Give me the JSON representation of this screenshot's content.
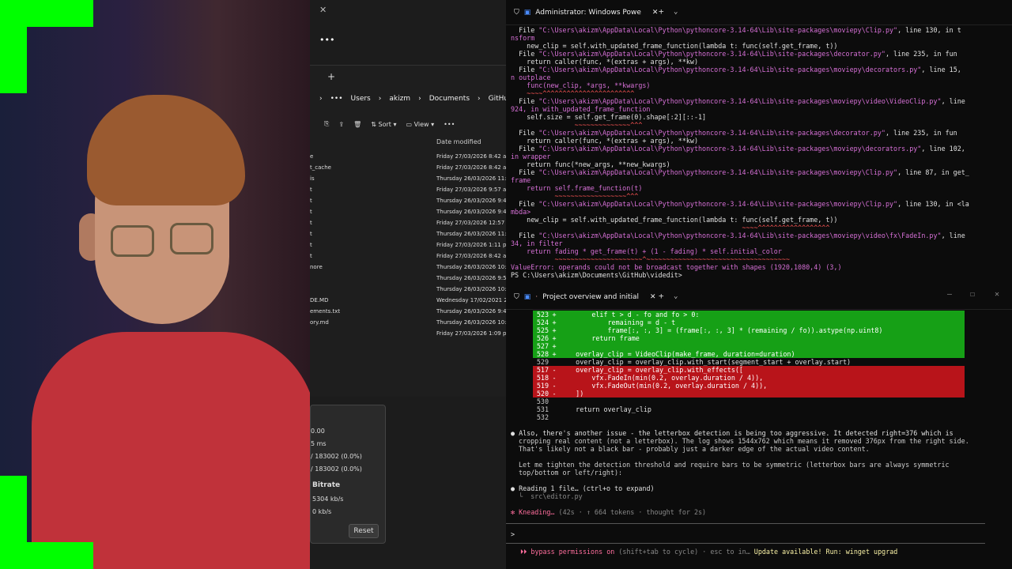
{
  "explorer": {
    "breadcrumbs": [
      "Users",
      "akizm",
      "Documents",
      "GitHub"
    ],
    "toolbar": {
      "sort": "Sort",
      "view": "View"
    },
    "column_date": "Date modified",
    "names": [
      "e",
      "t_cache",
      "is",
      "t",
      "t",
      "t",
      "t",
      "t",
      "t",
      "t",
      "nore",
      "",
      "",
      "DE.MD",
      "ements.txt",
      "ory.md"
    ],
    "dates": [
      "Friday 27/03/2026 8:42 am",
      "Friday 27/03/2026 8:42 am",
      "Thursday 26/03/2026 11:1",
      "Friday 27/03/2026 9:57 am",
      "Thursday 26/03/2026 9:4",
      "Thursday 26/03/2026 9:4",
      "Friday 27/03/2026 12:57 pm",
      "Thursday 26/03/2026 11:1",
      "Friday 27/03/2026 1:11 pm",
      "Friday 27/03/2026 8:42 am",
      "Thursday 26/03/2026 10:3",
      "Thursday 26/03/2026 9:5",
      "Thursday 26/03/2026 10:1",
      "Wednesday 17/02/2021 2",
      "Thursday 26/03/2026 9:4",
      "Thursday 26/03/2026 10:3",
      "Friday 27/03/2026 1:09 pm"
    ]
  },
  "stats": {
    "l1": "0.00",
    "l2": "5 ms",
    "l3": "/ 183002 (0.0%)",
    "l4": "/ 183002 (0.0%)",
    "bitrate_label": "Bitrate",
    "bitrate1": "5304 kb/s",
    "bitrate2": "0 kb/s",
    "reset": "Reset"
  },
  "term1": {
    "tab_title": "Administrator: Windows Powe",
    "lines": [
      {
        "t": "  File ",
        "c": "wh",
        "p": "\"C:\\Users\\akizm\\AppData\\Local\\Python\\pythoncore-3.14-64\\Lib\\site-packages\\moviepy\\Clip.py\"",
        "s": ", line 130, in t"
      },
      {
        "t": "nsform",
        "c": "mag"
      },
      {
        "t": "    new_clip = self.with_updated_frame_function(lambda t: func(self.get_frame, t))",
        "c": "wh"
      },
      {
        "t": "  File ",
        "c": "wh",
        "p": "\"C:\\Users\\akizm\\AppData\\Local\\Python\\pythoncore-3.14-64\\Lib\\site-packages\\decorator.py\"",
        "s": ", line 235, in fun"
      },
      {
        "t": "    return caller(func, *(extras + args), **kw)",
        "c": "wh"
      },
      {
        "t": "  File ",
        "c": "wh",
        "p": "\"C:\\Users\\akizm\\AppData\\Local\\Python\\pythoncore-3.14-64\\Lib\\site-packages\\moviepy\\decorators.py\"",
        "s": ", line 15,"
      },
      {
        "t": "n outplace",
        "c": "mag"
      },
      {
        "t": "    func(new_clip, *args, **kwargs)",
        "c": "mag"
      },
      {
        "t": "    ~~~~^^^^^^^^^^^^^^^^^^^^^^^",
        "c": "red"
      },
      {
        "t": "  File ",
        "c": "wh",
        "p": "\"C:\\Users\\akizm\\AppData\\Local\\Python\\pythoncore-3.14-64\\Lib\\site-packages\\moviepy\\video\\VideoClip.py\"",
        "s": ", line"
      },
      {
        "t": "924, in with_updated_frame_function",
        "c": "mag"
      },
      {
        "t": "    self.size = self.get_frame(0).shape[:2][::-1]",
        "c": "wh"
      },
      {
        "t": "                ~~~~~~~~~~~~~~^^^",
        "c": "red"
      },
      {
        "t": "  File ",
        "c": "wh",
        "p": "\"C:\\Users\\akizm\\AppData\\Local\\Python\\pythoncore-3.14-64\\Lib\\site-packages\\decorator.py\"",
        "s": ", line 235, in fun"
      },
      {
        "t": "    return caller(func, *(extras + args), **kw)",
        "c": "wh"
      },
      {
        "t": "  File ",
        "c": "wh",
        "p": "\"C:\\Users\\akizm\\AppData\\Local\\Python\\pythoncore-3.14-64\\Lib\\site-packages\\moviepy\\decorators.py\"",
        "s": ", line 102,"
      },
      {
        "t": "in wrapper",
        "c": "mag"
      },
      {
        "t": "    return func(*new_args, **new_kwargs)",
        "c": "wh"
      },
      {
        "t": "  File ",
        "c": "wh",
        "p": "\"C:\\Users\\akizm\\AppData\\Local\\Python\\pythoncore-3.14-64\\Lib\\site-packages\\moviepy\\Clip.py\"",
        "s": ", line 87, in get_"
      },
      {
        "t": "frame",
        "c": "mag"
      },
      {
        "t": "    return self.frame_function(t)",
        "c": "mag"
      },
      {
        "t": "           ~~~~~~~~~~~~~~~~~~^^^",
        "c": "red"
      },
      {
        "t": "  File ",
        "c": "wh",
        "p": "\"C:\\Users\\akizm\\AppData\\Local\\Python\\pythoncore-3.14-64\\Lib\\site-packages\\moviepy\\Clip.py\"",
        "s": ", line 130, in <la"
      },
      {
        "t": "mbda>",
        "c": "mag"
      },
      {
        "t": "    new_clip = self.with_updated_frame_function(lambda t: func(self.get_frame, t))",
        "c": "wh"
      },
      {
        "t": "                                                          ~~~~^^^^^^^^^^^^^^^^^^",
        "c": "red"
      },
      {
        "t": "  File ",
        "c": "wh",
        "p": "\"C:\\Users\\akizm\\AppData\\Local\\Python\\pythoncore-3.14-64\\Lib\\site-packages\\moviepy\\video\\fx\\FadeIn.py\"",
        "s": ", line"
      },
      {
        "t": "34, in filter",
        "c": "mag"
      },
      {
        "t": "    return fading * get_frame(t) + (1 - fading) * self.initial_color",
        "c": "mag"
      },
      {
        "t": "           ~~~~~~~~~~~~~~~~~~~~~~^~~~~~~~~~~~~~~~~~~~~~~~~~~~~~~~~~~~~",
        "c": "red"
      },
      {
        "t": "ValueError: operands could not be broadcast together with shapes (1920,1080,4) (3,)",
        "c": "mag"
      },
      {
        "t": "PS C:\\Users\\akizm\\Documents\\GitHub\\videdit>",
        "c": "wh"
      }
    ]
  },
  "term2": {
    "tab_title": "Project overview and initial",
    "diff": [
      {
        "n": "523",
        "m": "+",
        "code": "        elif t > d - fo and fo > 0:",
        "k": "g"
      },
      {
        "n": "524",
        "m": "+",
        "code": "            remaining = d - t",
        "k": "g"
      },
      {
        "n": "525",
        "m": "+",
        "code": "            frame[:, :, 3] = (frame[:, :, 3] * (remaining / fo)).astype(np.uint8)",
        "k": "g"
      },
      {
        "n": "526",
        "m": "+",
        "code": "        return frame",
        "k": "g"
      },
      {
        "n": "527",
        "m": "+",
        "code": "",
        "k": "g"
      },
      {
        "n": "528",
        "m": "+",
        "code": "    overlay_clip = VideoClip(make_frame, duration=duration)",
        "k": "g"
      },
      {
        "n": "529",
        "m": "",
        "code": "    overlay_clip = overlay_clip.with_start(segment_start + overlay.start)",
        "k": ""
      },
      {
        "n": "517",
        "m": "-",
        "code": "    overlay_clip = overlay_clip.with_effects([",
        "k": "r"
      },
      {
        "n": "518",
        "m": "-",
        "code": "        vfx.FadeIn(min(0.2, overlay.duration / 4)),",
        "k": "r"
      },
      {
        "n": "519",
        "m": "-",
        "code": "        vfx.FadeOut(min(0.2, overlay.duration / 4)),",
        "k": "r"
      },
      {
        "n": "520",
        "m": "-",
        "code": "    ])",
        "k": "r"
      },
      {
        "n": "530",
        "m": "",
        "code": "",
        "k": ""
      },
      {
        "n": "531",
        "m": "",
        "code": "    return overlay_clip",
        "k": ""
      },
      {
        "n": "532",
        "m": "",
        "code": "",
        "k": ""
      }
    ],
    "msg1": "Also, there's another issue - the letterbox detection is being too aggressive. It detected right=376 which is",
    "msg2": "cropping real content (not a letterbox). The log shows 1544x762 which means it removed 376px from the right side.",
    "msg3": "That's likely not a black bar - probably just a darker edge of the actual video content.",
    "msg4": "Let me tighten the detection threshold and require bars to be symmetric (letterbox bars are always symmetric",
    "msg5": "top/bottom or left/right):",
    "reading": "Reading 1 file… (ctrl+o to expand)",
    "reading_file": "└  src\\editor.py",
    "status_word": "Kneading…",
    "status_rest": " (42s · ↑ 664 tokens · thought for 2s)",
    "prompt": ">",
    "footer_bypass": "⏵⏵ bypass permissions on",
    "footer_hint": " (shift+tab to cycle) · esc to in…",
    "footer_update": "Update available! Run: winget upgrad"
  }
}
